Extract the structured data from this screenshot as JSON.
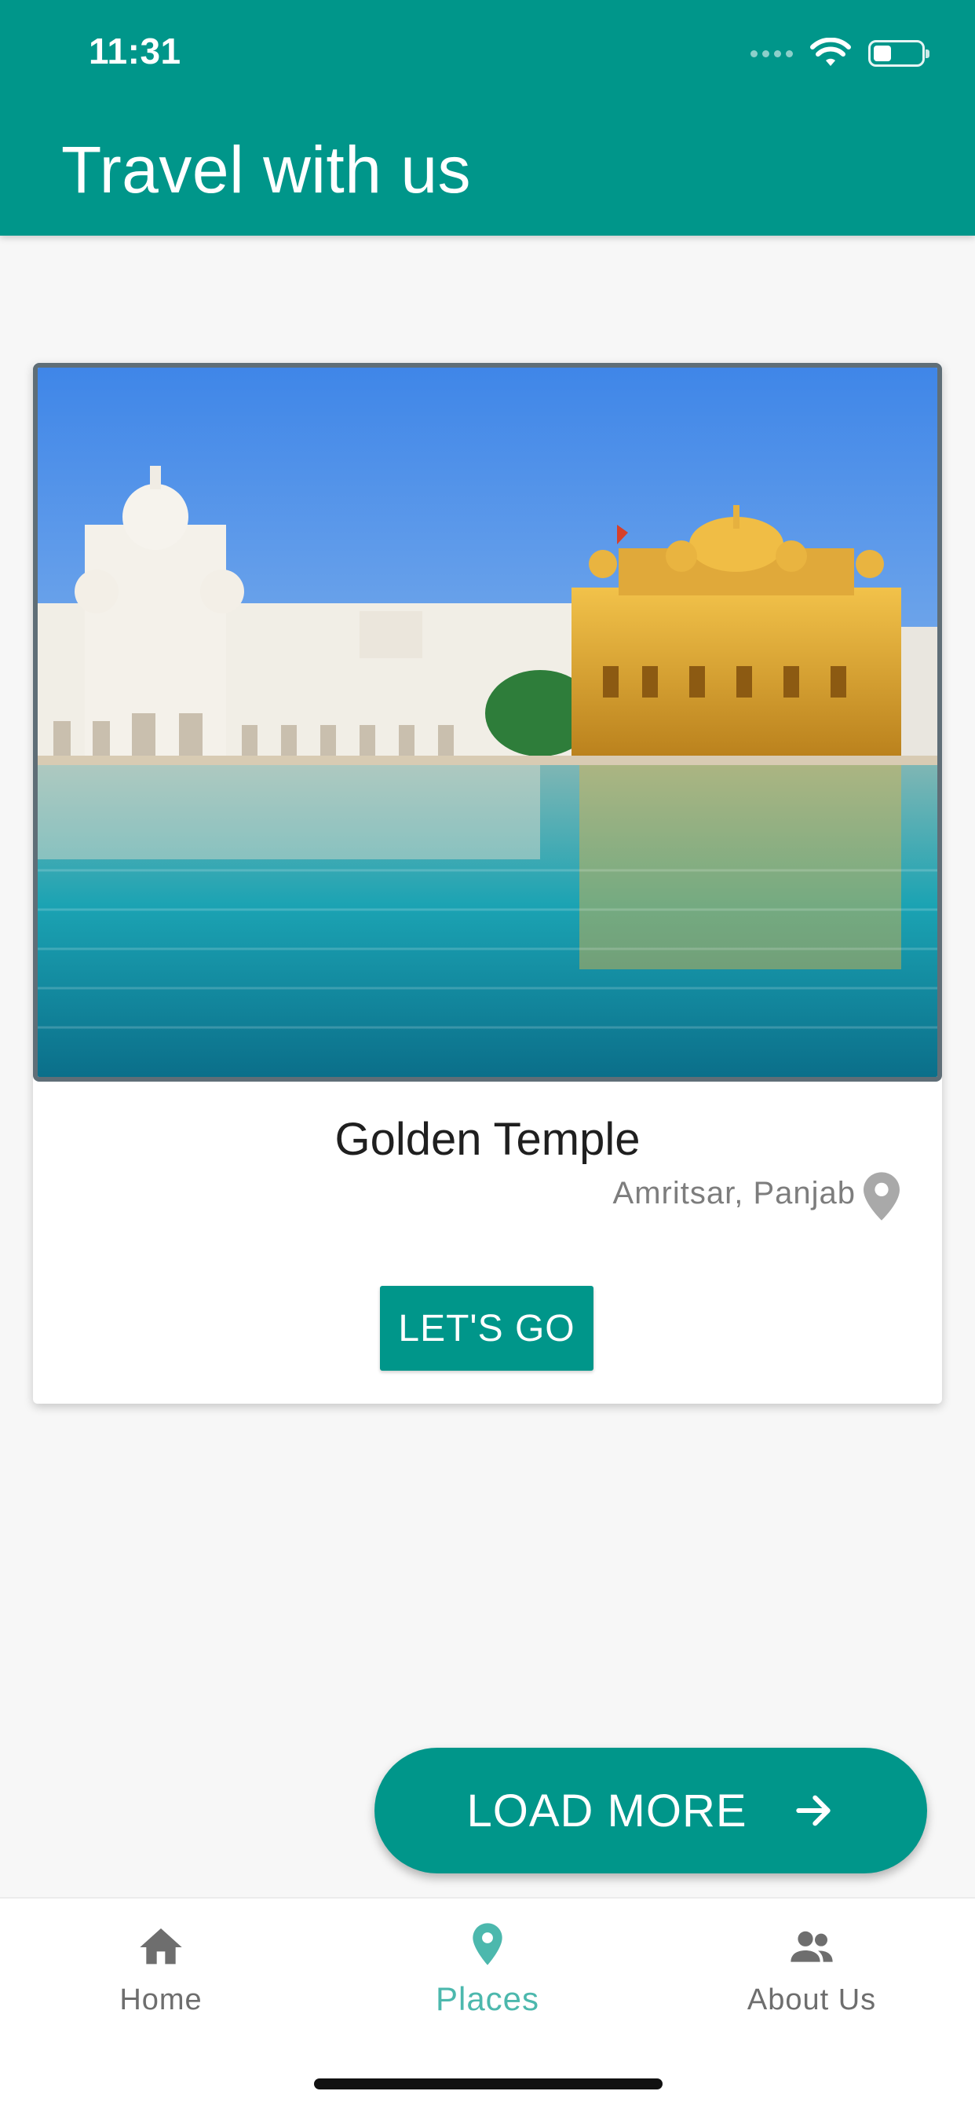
{
  "status_bar": {
    "time": "11:31"
  },
  "app_bar": {
    "title": "Travel with us"
  },
  "card": {
    "image_alt": "Golden Temple",
    "name": "Golden Temple",
    "location": "Amritsar, Panjab",
    "button_label": "LET'S GO"
  },
  "fab": {
    "label": "LOAD MORE"
  },
  "bottom_nav": {
    "items": [
      {
        "label": "Home",
        "icon": "home-icon",
        "active": false
      },
      {
        "label": "Places",
        "icon": "place-pin-icon",
        "active": true
      },
      {
        "label": "About Us",
        "icon": "people-icon",
        "active": false
      }
    ]
  },
  "colors": {
    "primary": "#00968a",
    "active_nav": "#4cb8ad",
    "inactive_nav": "#6e6e6e",
    "background": "#f7f7f7"
  }
}
